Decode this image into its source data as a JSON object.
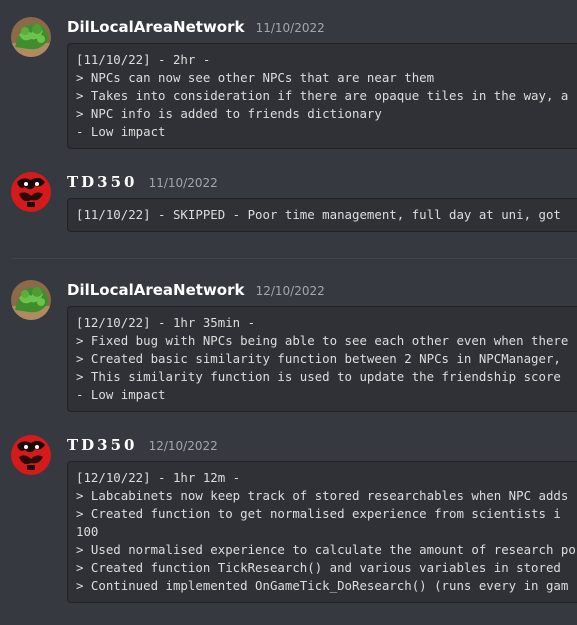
{
  "messages": [
    {
      "author": "DilLocalAreaNetwork",
      "timestamp": "11/10/2022",
      "avatar_icon": "plant-avatar-icon",
      "lines": [
        "[11/10/22] - 2hr -",
        "> NPCs can now see other NPCs that are near them",
        "> Takes into consideration if there are opaque tiles in the way, a",
        "> NPC info is added to friends dictionary",
        "- Low impact"
      ]
    },
    {
      "author": "TD350",
      "timestamp": "11/10/2022",
      "avatar_icon": "red-dragon-avatar-icon",
      "lines": [
        "[11/10/22] - SKIPPED - Poor time management, full day at uni, got"
      ]
    },
    {
      "author": "DilLocalAreaNetwork",
      "timestamp": "12/10/2022",
      "avatar_icon": "plant-avatar-icon",
      "lines": [
        "[12/10/22] - 1hr 35min -",
        "> Fixed bug with NPCs being able to see each other even when there",
        "> Created basic similarity function between 2 NPCs in NPCManager,",
        "> This similarity function is used to update the friendship score",
        "- Low impact"
      ]
    },
    {
      "author": "TD350",
      "timestamp": "12/10/2022",
      "avatar_icon": "red-dragon-avatar-icon",
      "lines": [
        "[12/10/22] - 1hr 12m -",
        "> Labcabinets now keep track of stored researchables when NPC adds",
        "> Created function to get normalised experience from scientists i",
        "100",
        "> Used normalised experience to calculate the amount of research po",
        "> Created function TickResearch() and various variables in stored",
        "> Continued implemented OnGameTick_DoResearch() (runs every in gam"
      ]
    }
  ],
  "colors": {
    "background": "#36393f",
    "codeblock_bg": "#2f3136",
    "author_text": "#ffffff",
    "timestamp_text": "#a3a6aa",
    "code_text": "#dcddde"
  }
}
